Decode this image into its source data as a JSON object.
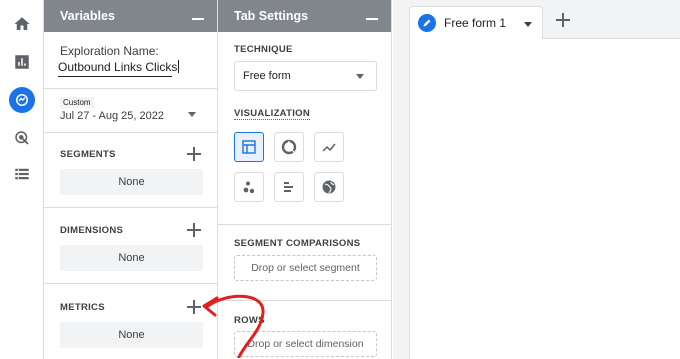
{
  "nav": {
    "items": [
      {
        "name": "home-icon"
      },
      {
        "name": "reports-icon"
      },
      {
        "name": "explore-icon",
        "active": true
      },
      {
        "name": "advertising-icon"
      },
      {
        "name": "configure-icon"
      }
    ]
  },
  "variables": {
    "title": "Variables",
    "exploration_label": "Exploration Name:",
    "exploration_name": "Outbound Links Clicks",
    "date_tag": "Custom",
    "date_range": "Jul 27 - Aug 25, 2022",
    "segments": {
      "title": "SEGMENTS",
      "empty": "None"
    },
    "dimensions": {
      "title": "DIMENSIONS",
      "empty": "None"
    },
    "metrics": {
      "title": "METRICS",
      "empty": "None"
    }
  },
  "tab_settings": {
    "title": "Tab Settings",
    "technique_label": "TECHNIQUE",
    "technique_value": "Free form",
    "visualization_label": "VISUALIZATION",
    "visualizations": [
      {
        "name": "table-viz",
        "selected": true
      },
      {
        "name": "donut-viz"
      },
      {
        "name": "line-viz"
      },
      {
        "name": "scatter-viz"
      },
      {
        "name": "bar-viz"
      },
      {
        "name": "geo-viz"
      }
    ],
    "segment_comparisons_label": "SEGMENT COMPARISONS",
    "segment_drop": "Drop or select segment",
    "rows_label": "ROWS",
    "rows_drop": "Drop or select dimension"
  },
  "tabs": {
    "active_label": "Free form 1"
  },
  "colors": {
    "accent": "#1a73e8",
    "panel_header": "#80868b",
    "annotation": "#e02020"
  }
}
